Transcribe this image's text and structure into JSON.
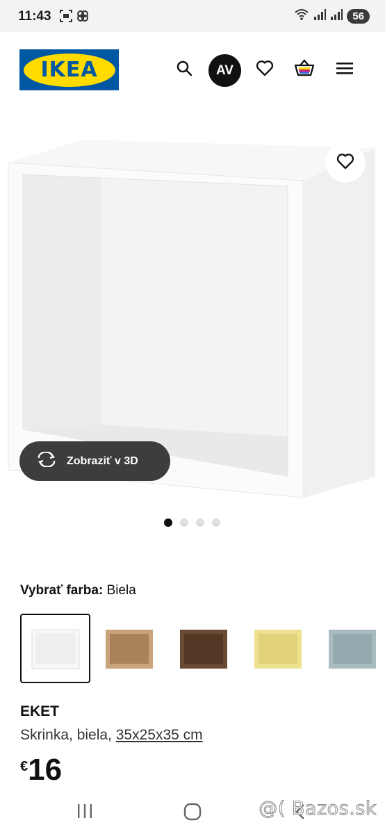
{
  "status": {
    "time": "11:43",
    "battery": "56"
  },
  "header": {
    "logo_text": "IKEA",
    "avatar_initials": "AV",
    "brand_blue": "#0058a3",
    "brand_yellow": "#ffdb00"
  },
  "product_image": {
    "view_3d_label": "Zobraziť v 3D",
    "carousel_pages": 4,
    "carousel_active": 1
  },
  "color_picker": {
    "label": "Vybrať farba:",
    "selected": "Biela",
    "swatches": [
      {
        "color": "#f8f8f6",
        "selected": true
      },
      {
        "color": "#c9a37a",
        "selected": false
      },
      {
        "color": "#6b4a34",
        "selected": false
      },
      {
        "color": "#ede08e",
        "selected": false
      },
      {
        "color": "#a8bcc0",
        "selected": false
      }
    ]
  },
  "product": {
    "name": "EKET",
    "description": "Skrinka, biela, ",
    "dimensions": "35x25x35 cm",
    "currency": "€",
    "price": "16"
  },
  "watermark": "@( Bazos.sk"
}
